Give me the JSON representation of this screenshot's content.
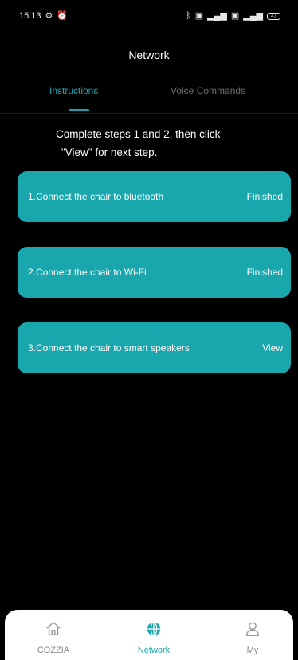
{
  "status_bar": {
    "time": "15:13",
    "left_icons": [
      "settings-gear-icon",
      "alarm-icon"
    ],
    "right_icons": [
      "bluetooth-icon",
      "nfc-icon",
      "signal-icon",
      "wifi-icon",
      "signal-icon",
      "battery-icon"
    ],
    "battery_level": "47"
  },
  "header": {
    "title": "Network"
  },
  "tabs": [
    {
      "label": "Instructions",
      "active": true
    },
    {
      "label": "Voice Commands",
      "active": false
    }
  ],
  "instructions": {
    "line1": "Complete steps 1 and 2, then click",
    "line2": "\"View\" for next step."
  },
  "steps": [
    {
      "label": "1.Connect the chair to bluetooth",
      "status": "Finished"
    },
    {
      "label": "2.Connect the chair to Wi-Fi",
      "status": "Finished"
    },
    {
      "label": "3.Connect the chair to smart speakers",
      "status": "View"
    }
  ],
  "bottom_nav": [
    {
      "label": "COZZIA",
      "icon": "home-icon",
      "active": false
    },
    {
      "label": "Network",
      "icon": "globe-icon",
      "active": true
    },
    {
      "label": "My",
      "icon": "user-icon",
      "active": false
    }
  ],
  "colors": {
    "background": "#000000",
    "accent": "#1aa6ad",
    "inactive_tab": "#6e6e6e",
    "nav_inactive": "#8c8c8c"
  }
}
